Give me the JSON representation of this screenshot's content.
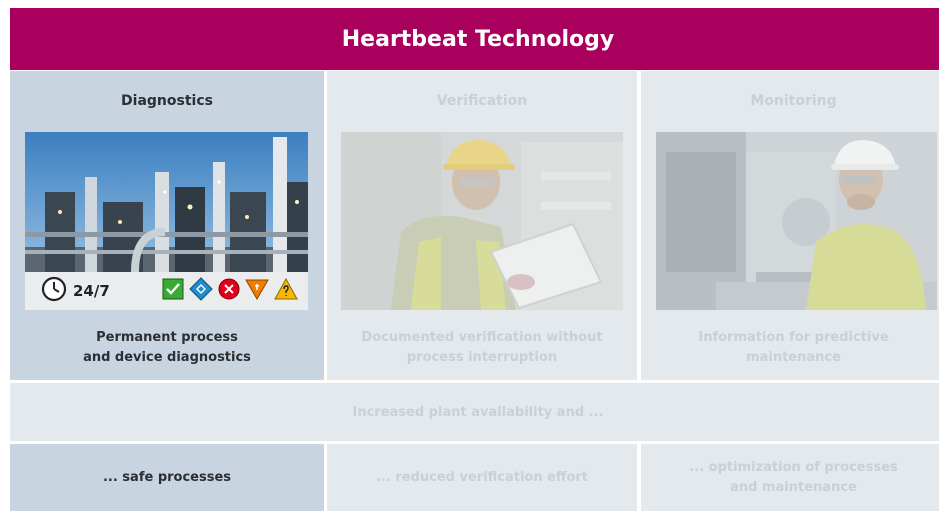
{
  "header": {
    "title": "Heartbeat Technology"
  },
  "columns": [
    {
      "title": "Diagnostics",
      "desc_line1": "Permanent process",
      "desc_line2": "and device diagnostics",
      "badge": "24/7"
    },
    {
      "title": "Verification",
      "desc_line1": "Documented verification without",
      "desc_line2": "process interruption"
    },
    {
      "title": "Monitoring",
      "desc_line1": "Information for predictive",
      "desc_line2": "maintenance"
    }
  ],
  "band": {
    "text": "Increased plant availability and ..."
  },
  "outcomes": [
    {
      "line1": "... safe processes",
      "line2": ""
    },
    {
      "line1": "... reduced verification effort",
      "line2": ""
    },
    {
      "line1": "... optimization of processes",
      "line2": "and maintenance"
    }
  ],
  "colors": {
    "brand": "#a8005c",
    "active_panel": "#c8d4df",
    "inactive_panel": "#e4e9ee",
    "status_ok": "#3aaa35",
    "status_check": "#1f8ccd",
    "status_failure": "#e2001a",
    "status_out_of_spec": "#f07d00",
    "status_maintenance": "#f6b800"
  },
  "icons": [
    "clock-icon",
    "status-ok-icon",
    "function-check-icon",
    "failure-icon",
    "out-of-specification-icon",
    "maintenance-required-icon"
  ]
}
